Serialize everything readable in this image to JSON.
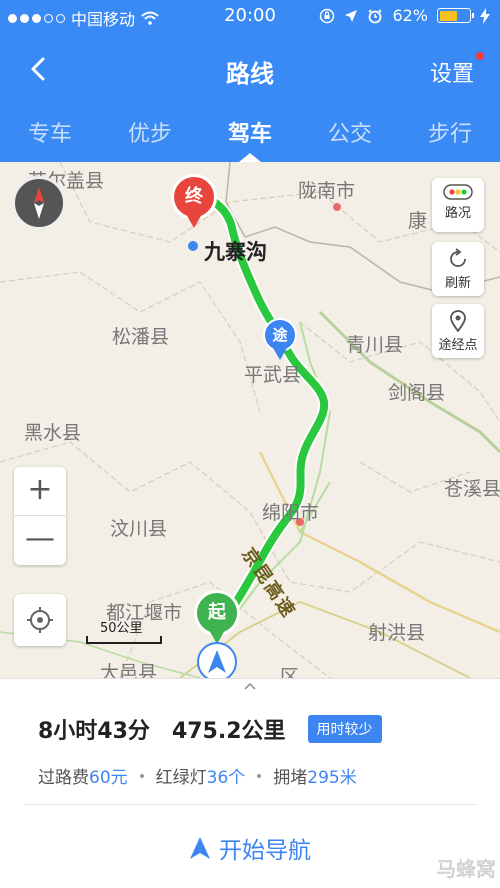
{
  "status_bar": {
    "carrier": "中国移动",
    "time": "20:00",
    "battery": "62%",
    "battery_level": 0.62
  },
  "nav": {
    "title": "路线",
    "settings_label": "设置"
  },
  "tabs": [
    {
      "label": "专车",
      "active": false
    },
    {
      "label": "优步",
      "active": false
    },
    {
      "label": "驾车",
      "active": true
    },
    {
      "label": "公交",
      "active": false
    },
    {
      "label": "步行",
      "active": false
    }
  ],
  "map": {
    "place_labels": {
      "ruoergai": "若尔盖县",
      "longnan": "陇南市",
      "kang": "康",
      "songpan": "松潘县",
      "qingchuan": "青川县",
      "pingwu": "平武县",
      "jiange": "剑阁县",
      "heishui": "黑水县",
      "cangxi": "苍溪县",
      "mianyang": "绵阳市",
      "wenchuan": "汶川县",
      "dujiangyan": "都江堰市",
      "shehong": "射洪县",
      "dayi": "大邑县",
      "qu": "区"
    },
    "destination_label": "九寨沟",
    "end_marker": "终",
    "start_marker": "起",
    "waypoint_marker": "途",
    "highway_label": "京昆高速",
    "scale_label": "50公里",
    "buttons": {
      "traffic": "路况",
      "refresh": "刷新",
      "waypoints": "途经点"
    },
    "zoom_in": "+",
    "zoom_out": "—"
  },
  "route": {
    "duration": "8小时43分",
    "distance": "475.2公里",
    "badge": "用时较少",
    "toll_label": "过路费",
    "toll_value": "60元",
    "lights_label": "红绿灯",
    "lights_value": "36个",
    "congestion_label": "拥堵",
    "congestion_value": "295米",
    "start_nav": "开始导航"
  },
  "watermark": "马蜂窝",
  "colors": {
    "primary": "#3a8af5",
    "route": "#2ac83c",
    "end_pin": "#e8453c",
    "start_pin": "#3fb34f",
    "waypoint": "#3d86f2"
  },
  "icons": [
    "back-chevron-icon",
    "wifi-icon",
    "location-arrow-icon",
    "alarm-icon",
    "compass-icon",
    "traffic-light-icon",
    "refresh-icon",
    "location-pin-icon",
    "locate-icon",
    "navigation-arrow-icon"
  ]
}
